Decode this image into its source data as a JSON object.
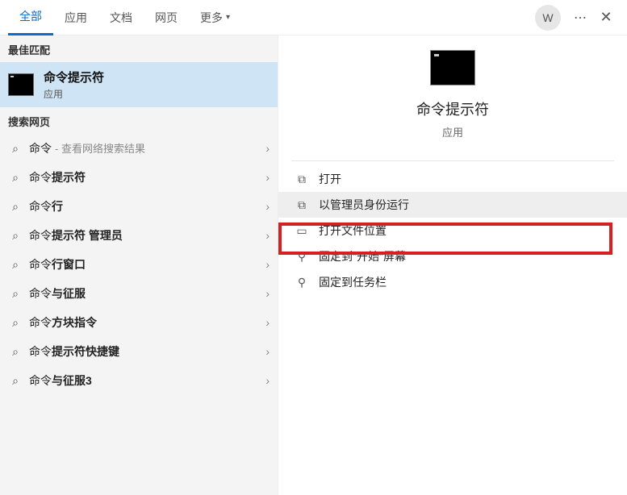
{
  "tabs": {
    "all": "全部",
    "apps": "应用",
    "docs": "文档",
    "web": "网页",
    "more": "更多"
  },
  "avatar": "W",
  "sections": {
    "best_match": "最佳匹配",
    "search_web": "搜索网页"
  },
  "best": {
    "title": "命令提示符",
    "sub": "应用"
  },
  "web_hint": "查看网络搜索结果",
  "suggestions": [
    {
      "pre": "命令",
      "bold": "",
      "post": ""
    },
    {
      "pre": "命令",
      "bold": "提示符",
      "post": ""
    },
    {
      "pre": "命令",
      "bold": "行",
      "post": ""
    },
    {
      "pre": "命令",
      "bold": "提示符 管理员",
      "post": ""
    },
    {
      "pre": "命令",
      "bold": "行窗口",
      "post": ""
    },
    {
      "pre": "命令",
      "bold": "与征服",
      "post": ""
    },
    {
      "pre": "命令",
      "bold": "方块指令",
      "post": ""
    },
    {
      "pre": "命令",
      "bold": "提示符快捷键",
      "post": ""
    },
    {
      "pre": "命令",
      "bold": "与征服3",
      "post": ""
    }
  ],
  "detail": {
    "title": "命令提示符",
    "sub": "应用"
  },
  "actions": {
    "open": "打开",
    "run_admin": "以管理员身份运行",
    "open_loc": "打开文件位置",
    "pin_start": "固定到\"开始\"屏幕",
    "pin_taskbar": "固定到任务栏"
  }
}
